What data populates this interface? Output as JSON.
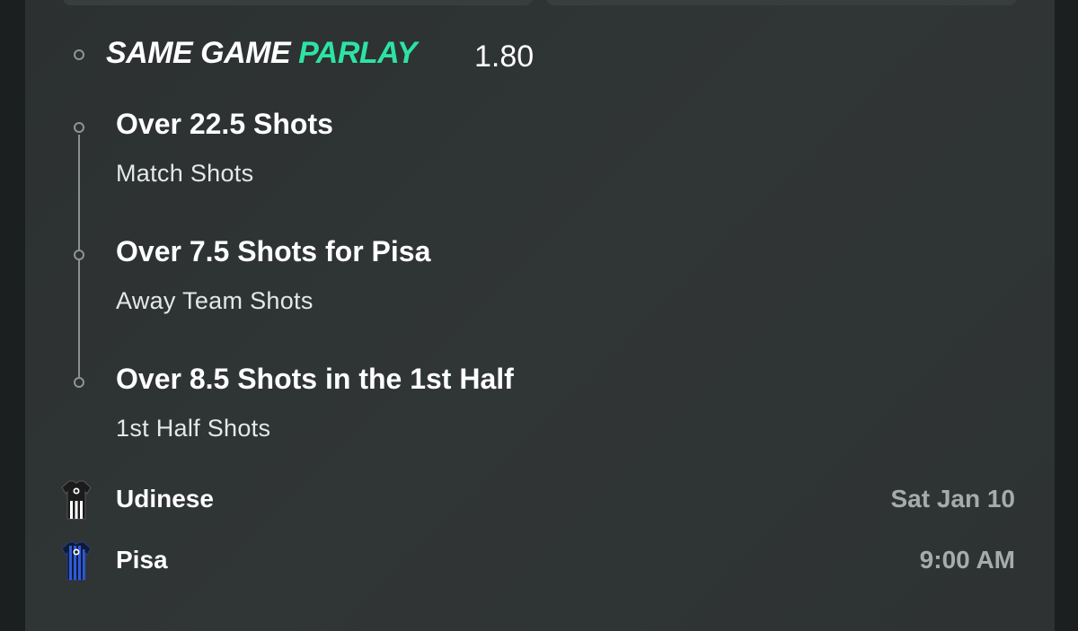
{
  "parlay": {
    "title_part1": "SAME GAME",
    "title_part2": "PARLAY",
    "odds": "1.80",
    "accent_color": "#2de3a4"
  },
  "legs": [
    {
      "title": "Over 22.5 Shots",
      "subtitle": "Match Shots"
    },
    {
      "title": "Over 7.5 Shots for Pisa",
      "subtitle": "Away Team Shots"
    },
    {
      "title": "Over 8.5 Shots in the 1st Half",
      "subtitle": "1st Half Shots"
    }
  ],
  "match": {
    "home": {
      "name": "Udinese",
      "jersey_icon": "udinese-jersey-icon"
    },
    "away": {
      "name": "Pisa",
      "jersey_icon": "pisa-jersey-icon"
    },
    "date": "Sat Jan 10",
    "time": "9:00 AM"
  }
}
